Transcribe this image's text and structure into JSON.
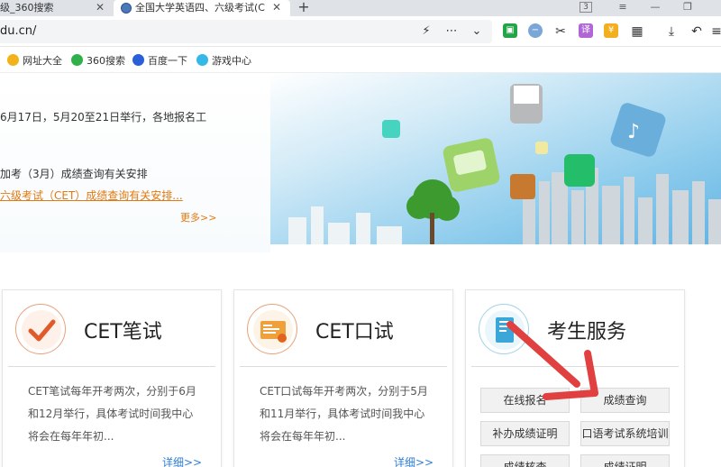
{
  "tabs": [
    {
      "title": "级_360搜索",
      "active": false
    },
    {
      "title": "全国大学英语四、六级考试(C",
      "active": true
    }
  ],
  "window": {
    "badge": "3"
  },
  "address": {
    "url": "du.cn/"
  },
  "bookmarks": [
    {
      "label": "网址大全",
      "icon": "360-browser-icon",
      "color": "#f3b21a"
    },
    {
      "label": "360搜索",
      "icon": "360-search-icon",
      "color": "#2fb04a"
    },
    {
      "label": "百度一下",
      "icon": "baidu-paw-icon",
      "color": "#2a5fd8"
    },
    {
      "label": "游戏中心",
      "icon": "game-center-icon",
      "color": "#35b8e8"
    }
  ],
  "news": {
    "item1": "6月17日，5月20至21日举行，各地报名工",
    "item2": "加考（3月）成绩查询有关安排",
    "item3": "六级考试（CET）成绩查询有关安排...",
    "more": "更多>>"
  },
  "cards": [
    {
      "title": "CET笔试",
      "icon": "checkmark-icon",
      "desc": "CET笔试每年开考两次，分别于6月和12月举行，具体考试时间我中心将会在每年年初...",
      "more": "详细>>"
    },
    {
      "title": "CET口试",
      "icon": "certificate-icon",
      "desc": "CET口试每年开考两次，分别于5月和11月举行，具体考试时间我中心将会在每年年初...",
      "more": "详细>>"
    },
    {
      "title": "考生服务",
      "icon": "notebook-icon",
      "buttons": [
        "在线报名",
        "成绩查询",
        "补办成绩证明",
        "口语考试系统培训",
        "成绩核查",
        "成绩证明"
      ]
    }
  ],
  "colors": {
    "accent_orange": "#e07a12",
    "link_blue": "#2f7fd6",
    "annotation_arrow": "#e04040"
  }
}
